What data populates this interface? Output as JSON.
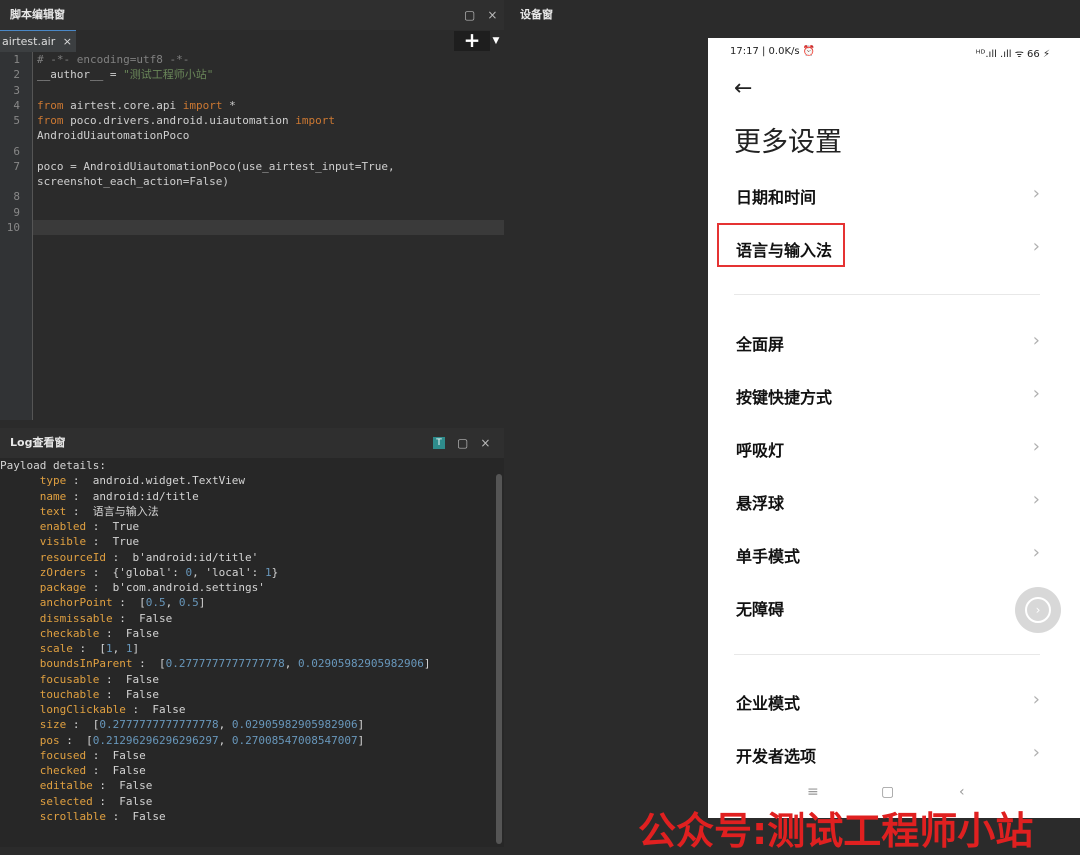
{
  "editor": {
    "title": "脚本编辑窗",
    "tab_label": "airtest.air",
    "tab_close": "×",
    "add_label": "+",
    "add_dropdown": "▼",
    "line_numbers": [
      "1",
      "2",
      "3",
      "4",
      "5",
      "",
      "6",
      "7",
      "",
      "8",
      "9",
      "10"
    ]
  },
  "window_buttons": {
    "restore": "▢",
    "close": "×"
  },
  "log": {
    "title": "Log查看窗",
    "filter_icon": "T",
    "header": "Payload details:",
    "entries": [
      {
        "key": "type",
        "value": "android.widget.TextView"
      },
      {
        "key": "name",
        "value": "android:id/title"
      },
      {
        "key": "text",
        "value": "语言与输入法"
      },
      {
        "key": "enabled",
        "value": "True"
      },
      {
        "key": "visible",
        "value": "True"
      },
      {
        "key": "resourceId",
        "value": "b'android:id/title'"
      },
      {
        "key": "zOrders",
        "value": "{'global': 0, 'local': 1}"
      },
      {
        "key": "package",
        "value": "b'com.android.settings'"
      },
      {
        "key": "anchorPoint",
        "value": "[0.5, 0.5]"
      },
      {
        "key": "dismissable",
        "value": "False"
      },
      {
        "key": "checkable",
        "value": "False"
      },
      {
        "key": "scale",
        "value": "[1, 1]"
      },
      {
        "key": "boundsInParent",
        "value": "[0.2777777777777778, 0.02905982905982906]"
      },
      {
        "key": "focusable",
        "value": "False"
      },
      {
        "key": "touchable",
        "value": "False"
      },
      {
        "key": "longClickable",
        "value": "False"
      },
      {
        "key": "size",
        "value": "[0.2777777777777778, 0.02905982905982906]"
      },
      {
        "key": "pos",
        "value": "[0.21296296296296297, 0.27008547008547007]"
      },
      {
        "key": "focused",
        "value": "False"
      },
      {
        "key": "checked",
        "value": "False"
      },
      {
        "key": "editalbe",
        "value": "False"
      },
      {
        "key": "selected",
        "value": "False"
      },
      {
        "key": "scrollable",
        "value": "False"
      }
    ]
  },
  "device": {
    "title": "设备窗",
    "status_time": "17:17 | 0.0K/s ⏰",
    "status_right": "ᴴᴰ.ıll .ıll ᯤ 66 ⚡",
    "back_arrow": "←",
    "page_title": "更多设置",
    "chevron": "›",
    "items": [
      "日期和时间",
      "语言与输入法",
      "全面屏",
      "按键快捷方式",
      "呼吸灯",
      "悬浮球",
      "单手模式",
      "无障碍",
      "企业模式",
      "开发者选项"
    ],
    "nav": {
      "menu": "≡",
      "home": "▢",
      "back": "‹"
    }
  },
  "watermark": "公众号:测试工程师小站"
}
